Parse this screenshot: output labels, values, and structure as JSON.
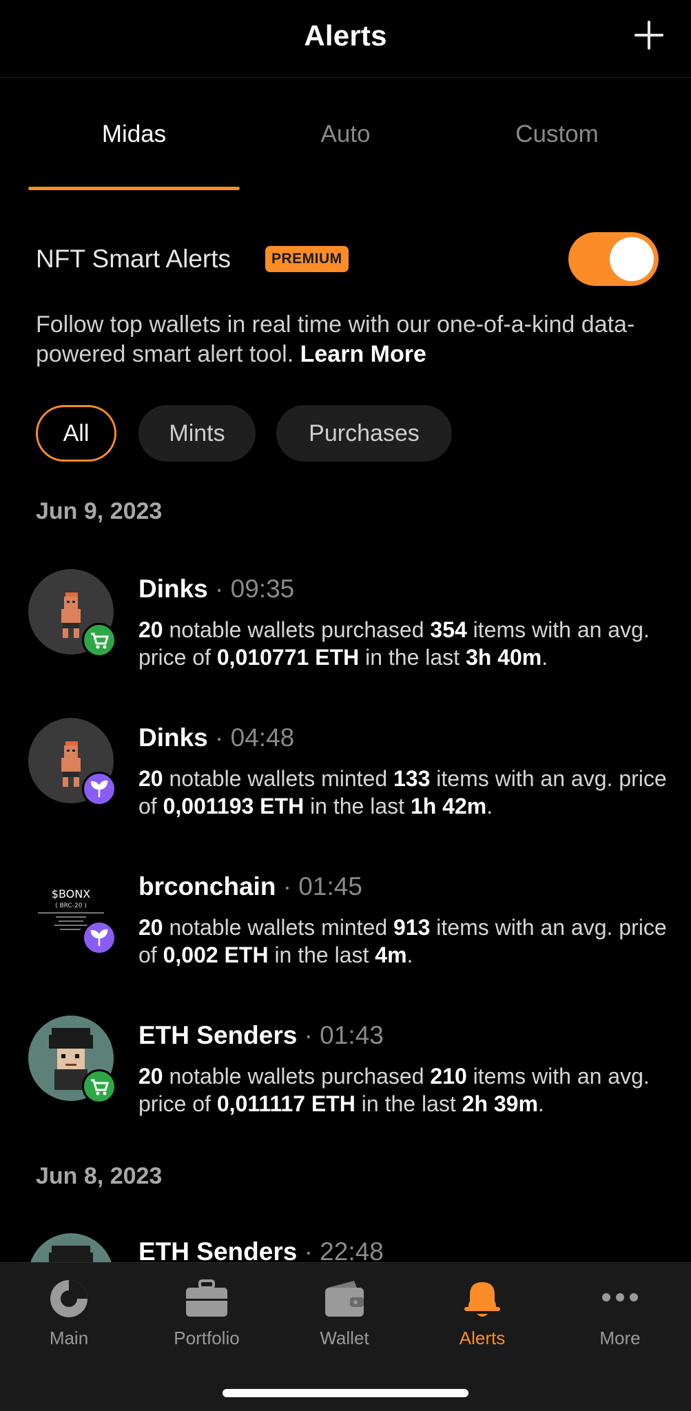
{
  "header": {
    "title": "Alerts"
  },
  "tabs": [
    {
      "label": "Midas"
    },
    {
      "label": "Auto"
    },
    {
      "label": "Custom"
    }
  ],
  "smart_alerts": {
    "title": "NFT Smart Alerts",
    "badge": "PREMIUM",
    "enabled": true,
    "description": "Follow top wallets in real time with our one-of-a-kind data-powered smart alert tool.",
    "learn_more": "Learn More"
  },
  "filters": [
    {
      "label": "All",
      "active": true
    },
    {
      "label": "Mints"
    },
    {
      "label": "Purchases"
    }
  ],
  "groups": [
    {
      "date": "Jun 9, 2023",
      "alerts": [
        {
          "name": "Dinks",
          "time": "· 09:35",
          "count": "20",
          "t1": " notable wallets purchased ",
          "items": "354",
          "t2": " items with an avg. price of ",
          "price": "0,010771 ETH",
          "t3": " in the last ",
          "period": "3h 40m",
          "t4": ".",
          "type": "cart-icon"
        },
        {
          "name": "Dinks",
          "time": "· 04:48",
          "count": "20",
          "t1": " notable wallets minted ",
          "items": "133",
          "t2": " items with an avg. price of ",
          "price": "0,001193 ETH",
          "t3": " in the last ",
          "period": "1h 42m",
          "t4": ".",
          "type": "sprout-icon"
        },
        {
          "name": "brconchain",
          "time": "· 01:45",
          "count": "20",
          "t1": " notable wallets minted ",
          "items": "913",
          "t2": " items with an avg. price of ",
          "price": "0,002 ETH",
          "t3": " in the last ",
          "period": "4m",
          "t4": ".",
          "type": "sprout-icon",
          "avatar_text": {
            "l1": "$BONX",
            "l2": "( BRC-20 )"
          }
        },
        {
          "name": "ETH Senders",
          "time": "· 01:43",
          "count": "20",
          "t1": " notable wallets purchased ",
          "items": "210",
          "t2": " items with an avg. price of ",
          "price": "0,011117 ETH",
          "t3": " in the last ",
          "period": "2h 39m",
          "t4": ".",
          "type": "cart-icon"
        }
      ]
    },
    {
      "date": "Jun 8, 2023",
      "alerts": [
        {
          "name": "ETH Senders",
          "time": "· 22:48"
        }
      ]
    }
  ],
  "bottom_nav": [
    {
      "label": "Main",
      "icon": "pie-chart-icon"
    },
    {
      "label": "Portfolio",
      "icon": "briefcase-icon"
    },
    {
      "label": "Wallet",
      "icon": "wallet-icon"
    },
    {
      "label": "Alerts",
      "icon": "bell-icon",
      "active": true
    },
    {
      "label": "More",
      "icon": "more-dots-icon"
    }
  ],
  "colors": {
    "accent": "#fb8c27",
    "purchase": "#2ea846",
    "mint": "#8a5cf6",
    "background": "#000000"
  }
}
